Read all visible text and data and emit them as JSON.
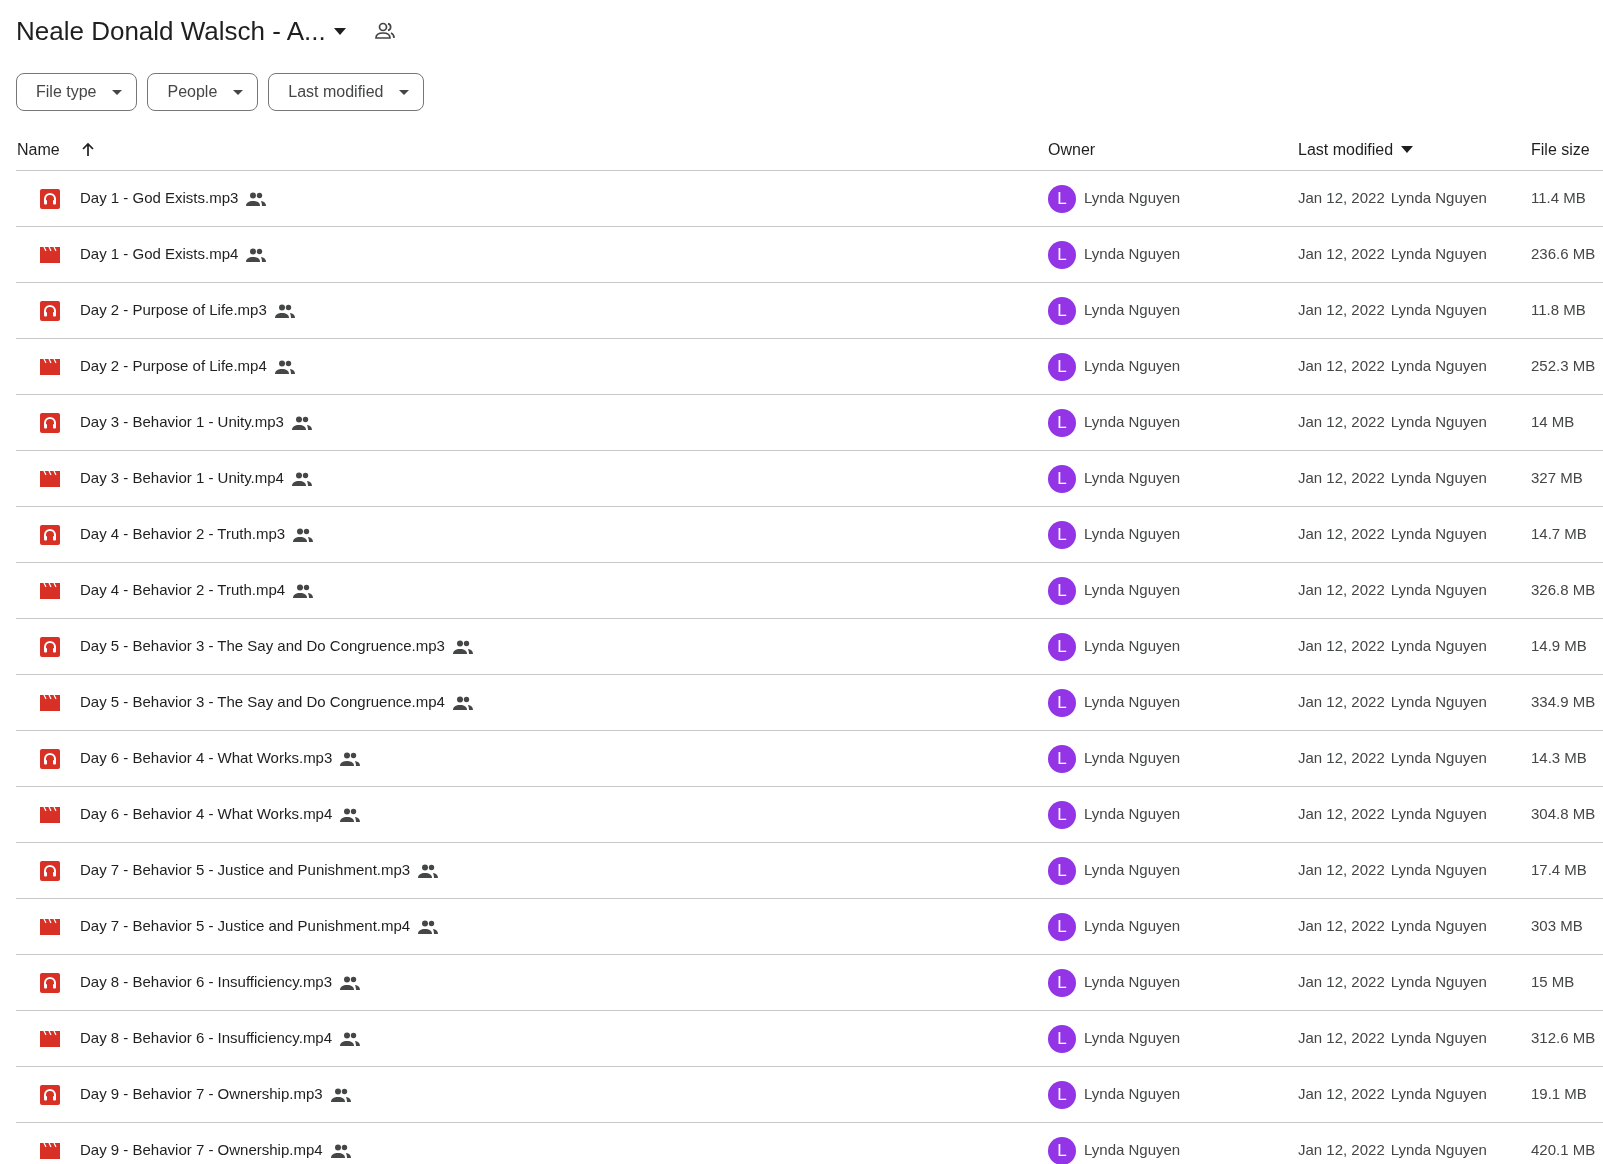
{
  "title": "Neale Donald Walsch - A...",
  "filters": [
    "File type",
    "People",
    "Last modified"
  ],
  "columns": {
    "name": "Name",
    "owner": "Owner",
    "modified": "Last modified",
    "size": "File size"
  },
  "rows": [
    {
      "kind": "audio",
      "name": "Day 1 - God Exists.mp3",
      "avatar": "L",
      "owner": "Lynda Nguyen",
      "date": "Jan 12, 2022",
      "modified_by": "Lynda Nguyen",
      "size": "11.4 MB"
    },
    {
      "kind": "video",
      "name": "Day 1 - God Exists.mp4",
      "avatar": "L",
      "owner": "Lynda Nguyen",
      "date": "Jan 12, 2022",
      "modified_by": "Lynda Nguyen",
      "size": "236.6 MB"
    },
    {
      "kind": "audio",
      "name": "Day 2 - Purpose of Life.mp3",
      "avatar": "L",
      "owner": "Lynda Nguyen",
      "date": "Jan 12, 2022",
      "modified_by": "Lynda Nguyen",
      "size": "11.8 MB"
    },
    {
      "kind": "video",
      "name": "Day 2 - Purpose of Life.mp4",
      "avatar": "L",
      "owner": "Lynda Nguyen",
      "date": "Jan 12, 2022",
      "modified_by": "Lynda Nguyen",
      "size": "252.3 MB"
    },
    {
      "kind": "audio",
      "name": "Day 3 - Behavior 1 - Unity.mp3",
      "avatar": "L",
      "owner": "Lynda Nguyen",
      "date": "Jan 12, 2022",
      "modified_by": "Lynda Nguyen",
      "size": "14 MB"
    },
    {
      "kind": "video",
      "name": "Day 3 - Behavior 1 - Unity.mp4",
      "avatar": "L",
      "owner": "Lynda Nguyen",
      "date": "Jan 12, 2022",
      "modified_by": "Lynda Nguyen",
      "size": "327 MB"
    },
    {
      "kind": "audio",
      "name": "Day 4 - Behavior 2 - Truth.mp3",
      "avatar": "L",
      "owner": "Lynda Nguyen",
      "date": "Jan 12, 2022",
      "modified_by": "Lynda Nguyen",
      "size": "14.7 MB"
    },
    {
      "kind": "video",
      "name": "Day 4 - Behavior 2 - Truth.mp4",
      "avatar": "L",
      "owner": "Lynda Nguyen",
      "date": "Jan 12, 2022",
      "modified_by": "Lynda Nguyen",
      "size": "326.8 MB"
    },
    {
      "kind": "audio",
      "name": "Day 5 - Behavior 3 - The Say and Do Congruence.mp3",
      "avatar": "L",
      "owner": "Lynda Nguyen",
      "date": "Jan 12, 2022",
      "modified_by": "Lynda Nguyen",
      "size": "14.9 MB"
    },
    {
      "kind": "video",
      "name": "Day 5 - Behavior 3 - The Say and Do Congruence.mp4",
      "avatar": "L",
      "owner": "Lynda Nguyen",
      "date": "Jan 12, 2022",
      "modified_by": "Lynda Nguyen",
      "size": "334.9 MB"
    },
    {
      "kind": "audio",
      "name": "Day 6 - Behavior 4 - What Works.mp3",
      "avatar": "L",
      "owner": "Lynda Nguyen",
      "date": "Jan 12, 2022",
      "modified_by": "Lynda Nguyen",
      "size": "14.3 MB"
    },
    {
      "kind": "video",
      "name": "Day 6 - Behavior 4 - What Works.mp4",
      "avatar": "L",
      "owner": "Lynda Nguyen",
      "date": "Jan 12, 2022",
      "modified_by": "Lynda Nguyen",
      "size": "304.8 MB"
    },
    {
      "kind": "audio",
      "name": "Day 7 - Behavior 5 - Justice and Punishment.mp3",
      "avatar": "L",
      "owner": "Lynda Nguyen",
      "date": "Jan 12, 2022",
      "modified_by": "Lynda Nguyen",
      "size": "17.4 MB"
    },
    {
      "kind": "video",
      "name": "Day 7 - Behavior 5 - Justice and Punishment.mp4",
      "avatar": "L",
      "owner": "Lynda Nguyen",
      "date": "Jan 12, 2022",
      "modified_by": "Lynda Nguyen",
      "size": "303 MB"
    },
    {
      "kind": "audio",
      "name": "Day 8 - Behavior 6 - Insufficiency.mp3",
      "avatar": "L",
      "owner": "Lynda Nguyen",
      "date": "Jan 12, 2022",
      "modified_by": "Lynda Nguyen",
      "size": "15 MB"
    },
    {
      "kind": "video",
      "name": "Day 8 - Behavior 6 - Insufficiency.mp4",
      "avatar": "L",
      "owner": "Lynda Nguyen",
      "date": "Jan 12, 2022",
      "modified_by": "Lynda Nguyen",
      "size": "312.6 MB"
    },
    {
      "kind": "audio",
      "name": "Day 9 - Behavior 7 - Ownership.mp3",
      "avatar": "L",
      "owner": "Lynda Nguyen",
      "date": "Jan 12, 2022",
      "modified_by": "Lynda Nguyen",
      "size": "19.1 MB"
    },
    {
      "kind": "video",
      "name": "Day 9 - Behavior 7 - Ownership.mp4",
      "avatar": "L",
      "owner": "Lynda Nguyen",
      "date": "Jan 12, 2022",
      "modified_by": "Lynda Nguyen",
      "size": "420.1 MB"
    }
  ]
}
